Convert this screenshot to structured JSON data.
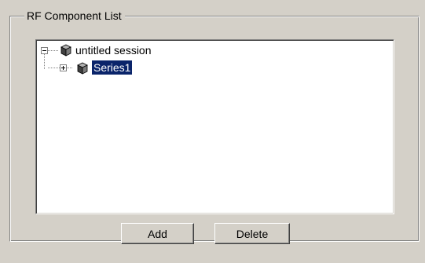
{
  "groupbox": {
    "title": "RF Component List"
  },
  "tree": {
    "root": {
      "label": "untitled session",
      "expanded": true,
      "icon": "cube-icon"
    },
    "children": [
      {
        "label": "Series1",
        "expanded": false,
        "selected": true,
        "icon": "cube-icon"
      }
    ]
  },
  "buttons": {
    "add_label": "Add",
    "delete_label": "Delete"
  },
  "colors": {
    "face": "#d4d0c8",
    "selection": "#0a246a",
    "selection_text": "#ffffff",
    "tree_background": "#ffffff"
  }
}
